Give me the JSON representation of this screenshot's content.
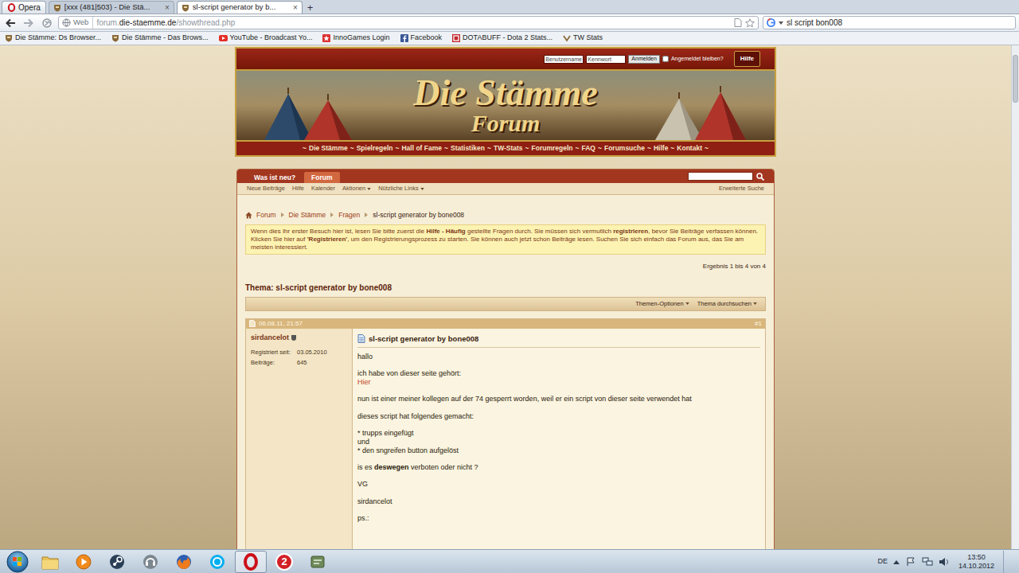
{
  "browser": {
    "menu_button": "Opera",
    "tabs": [
      {
        "label": "[xxx (481|503) - Die Stä...",
        "selected": false
      },
      {
        "label": "sl-script generator by b...",
        "selected": true
      }
    ],
    "tab_close": "×",
    "new_tab": "+",
    "web_badge": "Web",
    "url_prefix": "forum.",
    "url_host": "die-staemme.de",
    "url_path": "/showthread.php",
    "search_value": "sl script bon008",
    "bookmarks": [
      {
        "label": "Die Stämme: Ds Browser...",
        "kind": "staemme"
      },
      {
        "label": "Die Stämme - Das Brows...",
        "kind": "staemme"
      },
      {
        "label": "YouTube - Broadcast Yo...",
        "kind": "youtube"
      },
      {
        "label": "InnoGames Login",
        "kind": "innogames"
      },
      {
        "label": "Facebook",
        "kind": "facebook"
      },
      {
        "label": "DOTABUFF - Dota 2 Stats...",
        "kind": "dotabuff"
      },
      {
        "label": "TW Stats",
        "kind": "twstats"
      }
    ]
  },
  "forum": {
    "login": {
      "username_placeholder": "Benutzername",
      "password_placeholder": "Kennwort",
      "login_button": "Anmelden",
      "remember_label": "Angemeldet bleiben?",
      "remember_checked": false,
      "help_button": "Hilfe"
    },
    "banner": {
      "title": "Die Stämme",
      "subtitle": "Forum"
    },
    "nav": {
      "separator": "~",
      "links": [
        "Die Stämme",
        "Spielregeln",
        "Hall of Fame",
        "Statistiken",
        "TW-Stats",
        "Forumregeln",
        "FAQ",
        "Forumsuche",
        "Hilfe",
        "Kontakt"
      ]
    },
    "tabs": [
      {
        "label": "Was ist neu?",
        "selected": false
      },
      {
        "label": "Forum",
        "selected": true
      }
    ],
    "subnav": [
      {
        "label": "Neue Beiträge",
        "dropdown": false
      },
      {
        "label": "Hilfe",
        "dropdown": false
      },
      {
        "label": "Kalender",
        "dropdown": false
      },
      {
        "label": "Aktionen",
        "dropdown": true
      },
      {
        "label": "Nützliche Links",
        "dropdown": true
      }
    ],
    "advanced_search": "Erweiterte Suche",
    "breadcrumb": [
      {
        "label": "Forum",
        "current": false
      },
      {
        "label": "Die Stämme",
        "current": false
      },
      {
        "label": "Fragen",
        "current": false
      },
      {
        "label": "sl-script generator by bone008",
        "current": true
      }
    ],
    "notice": [
      {
        "text": "Wenn dies Ihr erster Besuch hier ist, lesen Sie bitte zuerst die ",
        "bold": false
      },
      {
        "text": "Hilfe - Häufig",
        "bold": true
      },
      {
        "text": " gestellte Fragen durch. Sie müssen sich vermutlich ",
        "bold": false
      },
      {
        "text": "registrieren",
        "bold": true
      },
      {
        "text": ", bevor Sie Beiträge verfassen können. Klicken Sie hier auf ",
        "bold": false
      },
      {
        "text": "'Registrieren'",
        "bold": true
      },
      {
        "text": ", um den Registrierungsprozess zu starten. Sie können auch jetzt schon Beiträge lesen. Suchen Sie sich einfach das Forum aus, das Sie am meisten interessiert.",
        "bold": false
      }
    ],
    "result_count": "Ergebnis 1 bis 4 von 4",
    "thread_title": "Thema: sl-script generator by bone008",
    "thread_tools": [
      {
        "label": "Themen-Optionen"
      },
      {
        "label": "Thema durchsuchen"
      }
    ],
    "post": {
      "date": "06.08.11, 21:57",
      "number": "#1",
      "author": "sirdancelot",
      "online": false,
      "stats": [
        {
          "label": "Registriert seit:",
          "value": "03.05.2010"
        },
        {
          "label": "Beiträge:",
          "value": "645"
        }
      ],
      "title": "sl-script generator by bone008",
      "body": [
        [
          [
            {
              "text": "hallo",
              "kind": "plain"
            }
          ]
        ],
        [
          [
            {
              "text": "ich habe von dieser seite gehört:",
              "kind": "plain"
            }
          ],
          [
            {
              "text": "Hier",
              "kind": "link"
            }
          ]
        ],
        [
          [
            {
              "text": "nun ist einer meiner kollegen auf der 74 gesperrt worden, weil er ein script von dieser seite verwendet hat",
              "kind": "plain"
            }
          ]
        ],
        [
          [
            {
              "text": "dieses script hat folgendes gemacht:",
              "kind": "plain"
            }
          ]
        ],
        [
          [
            {
              "text": "* trupps eingefügt",
              "kind": "plain"
            }
          ],
          [
            {
              "text": "und",
              "kind": "plain"
            }
          ],
          [
            {
              "text": "* den sngreifen button aufgelöst",
              "kind": "plain"
            }
          ]
        ],
        [
          [
            {
              "text": "is es ",
              "kind": "plain"
            },
            {
              "text": "deswegen",
              "kind": "bold"
            },
            {
              "text": " verboten oder nicht ?",
              "kind": "plain"
            }
          ]
        ],
        [
          [
            {
              "text": "VG",
              "kind": "plain"
            }
          ]
        ],
        [
          [
            {
              "text": "sirdancelot",
              "kind": "plain"
            }
          ]
        ],
        [
          [
            {
              "text": "ps.:",
              "kind": "plain"
            }
          ]
        ]
      ]
    }
  },
  "taskbar": {
    "apps": [
      {
        "kind": "explorer",
        "label": "",
        "active": false
      },
      {
        "kind": "mediaplayer",
        "label": "",
        "active": false
      },
      {
        "kind": "steam",
        "label": "",
        "active": false
      },
      {
        "kind": "teamspeak",
        "label": "",
        "active": false
      },
      {
        "kind": "firefox",
        "label": "",
        "active": false
      },
      {
        "kind": "skype",
        "label": "",
        "active": false
      },
      {
        "kind": "opera",
        "label": "",
        "active": true
      },
      {
        "kind": "badge",
        "label": "2",
        "active": false
      },
      {
        "kind": "tool",
        "label": "",
        "active": false
      }
    ],
    "language": "DE",
    "time": "13:50",
    "date": "14.10.2012"
  }
}
